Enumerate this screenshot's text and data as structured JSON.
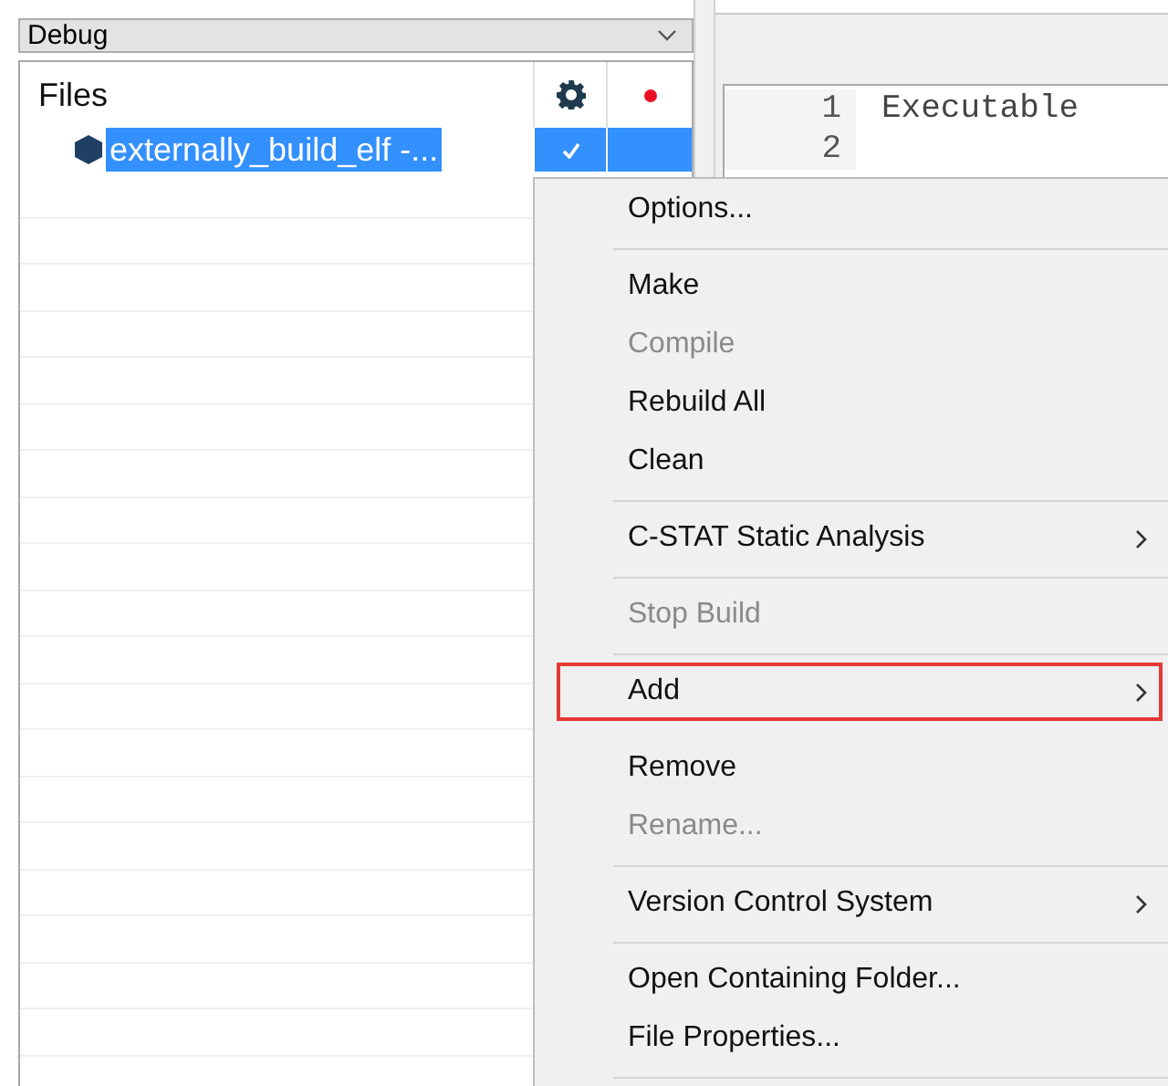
{
  "config_dropdown": {
    "value": "Debug"
  },
  "workspace": {
    "header": "Files",
    "rows": [
      {
        "name": "externally_build_elf -...",
        "selected": true,
        "checked": true
      }
    ],
    "status_dot": {
      "color": "#e81123"
    }
  },
  "editor": {
    "lines": [
      {
        "number": "1",
        "text": "Executable"
      },
      {
        "number": "2"
      }
    ]
  },
  "context_menu": {
    "items": [
      {
        "kind": "item",
        "label": "Options...",
        "disabled": false,
        "submenu": false,
        "selected": false
      },
      {
        "kind": "separator"
      },
      {
        "kind": "item",
        "label": "Make",
        "disabled": false,
        "submenu": false,
        "selected": false
      },
      {
        "kind": "item",
        "label": "Compile",
        "disabled": true,
        "submenu": false,
        "selected": false
      },
      {
        "kind": "item",
        "label": "Rebuild All",
        "disabled": false,
        "submenu": false,
        "selected": false
      },
      {
        "kind": "item",
        "label": "Clean",
        "disabled": false,
        "submenu": false,
        "selected": false
      },
      {
        "kind": "separator"
      },
      {
        "kind": "item",
        "label": "C-STAT Static Analysis",
        "disabled": false,
        "submenu": true,
        "selected": false
      },
      {
        "kind": "separator"
      },
      {
        "kind": "item",
        "label": "Stop Build",
        "disabled": true,
        "submenu": false,
        "selected": false
      },
      {
        "kind": "separator"
      },
      {
        "kind": "item",
        "label": "Add",
        "disabled": false,
        "submenu": true,
        "selected": true
      },
      {
        "kind": "item",
        "label": "Remove",
        "disabled": false,
        "submenu": false,
        "selected": false
      },
      {
        "kind": "item",
        "label": "Rename...",
        "disabled": true,
        "submenu": false,
        "selected": false
      },
      {
        "kind": "separator"
      },
      {
        "kind": "item",
        "label": "Version Control System",
        "disabled": false,
        "submenu": true,
        "selected": false
      },
      {
        "kind": "separator"
      },
      {
        "kind": "item",
        "label": "Open Containing Folder...",
        "disabled": false,
        "submenu": false,
        "selected": false
      },
      {
        "kind": "item",
        "label": "File Properties...",
        "disabled": false,
        "submenu": false,
        "selected": false
      },
      {
        "kind": "separator"
      }
    ]
  }
}
